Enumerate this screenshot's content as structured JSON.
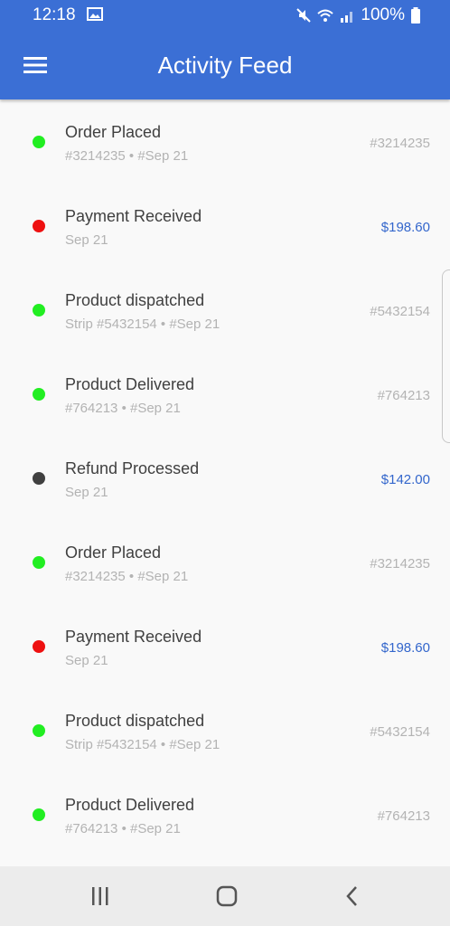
{
  "status_bar": {
    "time": "12:18",
    "battery_text": "100%",
    "icons": [
      "image-icon",
      "mute-icon",
      "wifi-icon",
      "signal-icon",
      "battery-icon"
    ]
  },
  "app_bar": {
    "title": "Activity Feed",
    "color": "#3b6fd5",
    "menu_icon": "menu-icon"
  },
  "feed": {
    "items": [
      {
        "title": "Order Placed",
        "subtitle": "#3214235 • #Sep 21",
        "right": "#3214235",
        "right_type": "ref",
        "status_color": "#22ee22"
      },
      {
        "title": "Payment Received",
        "subtitle": "Sep 21",
        "right": "$198.60",
        "right_type": "amount",
        "status_color": "#ee1111"
      },
      {
        "title": "Product dispatched",
        "subtitle": "Strip #5432154 • #Sep 21",
        "right": "#5432154",
        "right_type": "ref",
        "status_color": "#22ee22"
      },
      {
        "title": "Product Delivered",
        "subtitle": "#764213 • #Sep 21",
        "right": "#764213",
        "right_type": "ref",
        "status_color": "#22ee22"
      },
      {
        "title": "Refund Processed",
        "subtitle": "Sep 21",
        "right": "$142.00",
        "right_type": "amount",
        "status_color": "#404040"
      },
      {
        "title": "Order Placed",
        "subtitle": "#3214235 • #Sep 21",
        "right": "#3214235",
        "right_type": "ref",
        "status_color": "#22ee22"
      },
      {
        "title": "Payment Received",
        "subtitle": "Sep 21",
        "right": "$198.60",
        "right_type": "amount",
        "status_color": "#ee1111"
      },
      {
        "title": "Product dispatched",
        "subtitle": "Strip #5432154 • #Sep 21",
        "right": "#5432154",
        "right_type": "ref",
        "status_color": "#22ee22"
      },
      {
        "title": "Product Delivered",
        "subtitle": "#764213 • #Sep 21",
        "right": "#764213",
        "right_type": "ref",
        "status_color": "#22ee22"
      }
    ]
  },
  "nav_bar": {
    "icons": [
      "recents-icon",
      "home-icon",
      "back-icon"
    ]
  }
}
